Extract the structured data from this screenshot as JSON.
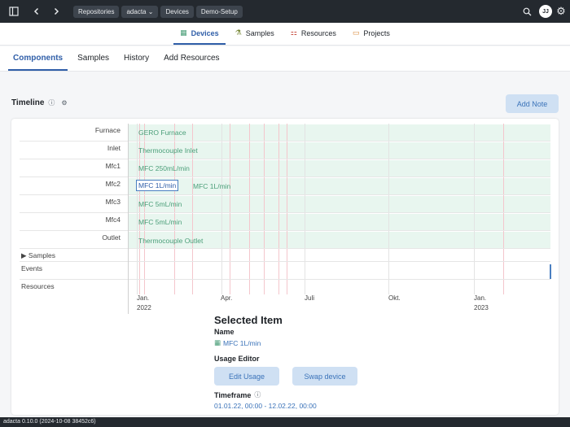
{
  "topbar": {
    "breadcrumbs": [
      "Repositories",
      "adacta",
      "Devices",
      "Demo-Setup"
    ],
    "avatar_initials": "JJ"
  },
  "mainnav": {
    "tabs": [
      {
        "label": "Devices",
        "icon": "devices-icon"
      },
      {
        "label": "Samples",
        "icon": "samples-icon"
      },
      {
        "label": "Resources",
        "icon": "resources-icon"
      },
      {
        "label": "Projects",
        "icon": "projects-icon"
      }
    ],
    "active": "Devices"
  },
  "subnav": {
    "tabs": [
      "Components",
      "Samples",
      "History",
      "Add Resources"
    ],
    "active": "Components"
  },
  "timeline": {
    "title": "Timeline",
    "add_note_label": "Add Note",
    "rows": [
      {
        "label": "Furnace",
        "bars": [
          "GERO Furnace"
        ]
      },
      {
        "label": "Inlet",
        "bars": [
          "Thermocouple Inlet"
        ]
      },
      {
        "label": "Mfc1",
        "bars": [
          "MFC 250mL/min"
        ]
      },
      {
        "label": "Mfc2",
        "bars": [
          "MFC 1L/min",
          "MFC 1L/min"
        ]
      },
      {
        "label": "Mfc3",
        "bars": [
          "MFC 5mL/min"
        ]
      },
      {
        "label": "Mfc4",
        "bars": [
          "MFC 5mL/min"
        ]
      },
      {
        "label": "Outlet",
        "bars": [
          "Thermocouple Outlet"
        ]
      }
    ],
    "samples_label": "Samples",
    "events_label": "Events",
    "resources_label": "Resources",
    "axis": [
      {
        "label": "Jan.",
        "year": "2022"
      },
      {
        "label": "Apr.",
        "year": ""
      },
      {
        "label": "Juli",
        "year": ""
      },
      {
        "label": "Okt.",
        "year": ""
      },
      {
        "label": "Jan.",
        "year": "2023"
      }
    ]
  },
  "selected": {
    "title": "Selected Item",
    "name_label": "Name",
    "name_value": "MFC 1L/min",
    "usage_editor_label": "Usage Editor",
    "edit_usage_label": "Edit Usage",
    "swap_device_label": "Swap device",
    "timeframe_label": "Timeframe",
    "timeframe_value": "01.01.22, 00:00 - 12.02.22, 00:00"
  },
  "statusbar": {
    "text": "adacta 0.10.0 (2024-10-08 38452c6)"
  },
  "colors": {
    "accent": "#2f5ea8",
    "lane": "#e8f6ef",
    "lane_text": "#4a9e78",
    "button_bg": "#cfe0f3"
  }
}
